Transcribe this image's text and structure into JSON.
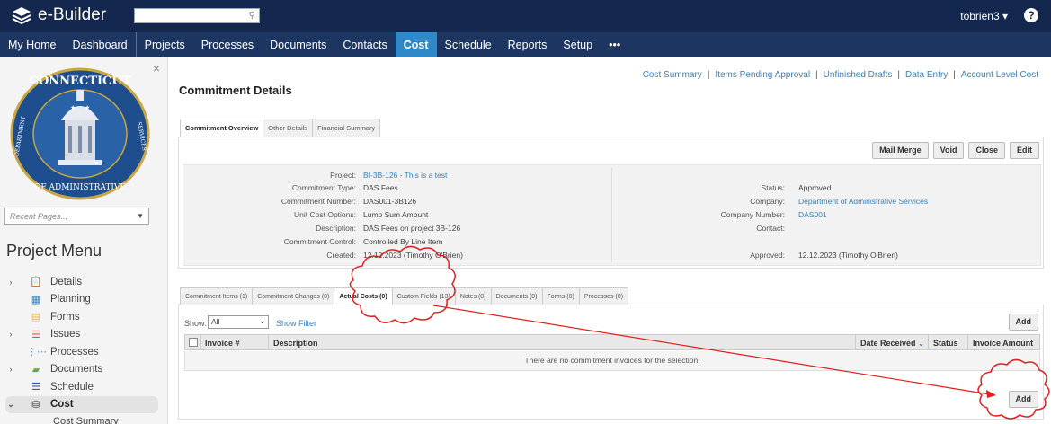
{
  "app": {
    "brand": "e-Builder",
    "user": "tobrien3",
    "user_caret": "▾",
    "help": "?"
  },
  "nav": {
    "items": [
      {
        "label": "My Home"
      },
      {
        "label": "Dashboard"
      },
      {
        "label": "Projects"
      },
      {
        "label": "Processes"
      },
      {
        "label": "Documents"
      },
      {
        "label": "Contacts"
      },
      {
        "label": "Cost",
        "active": true
      },
      {
        "label": "Schedule"
      },
      {
        "label": "Reports"
      },
      {
        "label": "Setup"
      },
      {
        "label": "•••"
      }
    ]
  },
  "sidebar": {
    "close": "×",
    "seal_text_top": "CONNECTICUT",
    "seal_text_side": "DEPARTMENT",
    "seal_text_bottom": "OF ADMINISTRATIVE",
    "seal_text_right": "SERVICES",
    "recent_placeholder": "Recent Pages...",
    "project_menu_title": "Project Menu",
    "items": [
      {
        "label": "Details",
        "chevron": "›",
        "icon": "clipboard-icon"
      },
      {
        "label": "Planning",
        "chevron": "",
        "icon": "calendar-people-icon"
      },
      {
        "label": "Forms",
        "chevron": "",
        "icon": "form-icon"
      },
      {
        "label": "Issues",
        "chevron": "›",
        "icon": "list-icon"
      },
      {
        "label": "Processes",
        "chevron": "",
        "icon": "process-icon"
      },
      {
        "label": "Documents",
        "chevron": "›",
        "icon": "folder-icon"
      },
      {
        "label": "Schedule",
        "chevron": "",
        "icon": "schedule-icon"
      },
      {
        "label": "Cost",
        "chevron": "⌄",
        "icon": "cost-icon",
        "active": true
      }
    ],
    "sub_item": "Cost Summary"
  },
  "main": {
    "sublinks": [
      "Cost Summary",
      "Items Pending Approval",
      "Unfinished Drafts",
      "Data Entry",
      "Account Level Cost"
    ],
    "title": "Commitment Details",
    "tabs": [
      "Commitment Overview",
      "Other Details",
      "Financial Summary"
    ],
    "buttons": [
      "Mail Merge",
      "Void",
      "Close",
      "Edit"
    ],
    "left_fields": [
      {
        "label": "Project:",
        "value": "BI-3B-126 - This is a test",
        "link": true
      },
      {
        "label": "Commitment Type:",
        "value": "DAS Fees"
      },
      {
        "label": "Commitment Number:",
        "value": "DAS001-3B126"
      },
      {
        "label": "Unit Cost Options:",
        "value": "Lump Sum Amount"
      },
      {
        "label": "Description:",
        "value": "DAS Fees on project 3B-126"
      },
      {
        "label": "Commitment Control:",
        "value": "Controlled By Line Item"
      },
      {
        "label": "Created:",
        "value": "12.12.2023 (Timothy O'Brien)"
      }
    ],
    "right_fields": [
      {
        "label": "Status:",
        "value": "Approved"
      },
      {
        "label": "Company:",
        "value": "Department of Administrative Services",
        "link": true
      },
      {
        "label": "Company Number:",
        "value": "DAS001",
        "link": true
      },
      {
        "label": "Contact:",
        "value": ""
      },
      {
        "label": "Approved:",
        "value": "12.12.2023 (Timothy O'Brien)"
      }
    ],
    "subtabs": [
      "Commitment Items (1)",
      "Commitment Changes (0)",
      "Actual Costs (0)",
      "Custom Fields (13)",
      "Notes (0)",
      "Documents (0)",
      "Forms (0)",
      "Processes (0)"
    ],
    "active_subtab": 2,
    "show_label": "Show:",
    "show_value": "All",
    "show_filter": "Show Filter",
    "add_label": "Add",
    "columns": [
      "Invoice #",
      "Description",
      "Date Received",
      "Status",
      "Invoice Amount"
    ],
    "empty_message": "There are no commitment invoices for the selection."
  },
  "colors": {
    "topbar": "#14274e",
    "navbar": "#1d3561",
    "active_tab": "#2f88c8",
    "link": "#3a80b5",
    "annotation": "#e02020"
  }
}
